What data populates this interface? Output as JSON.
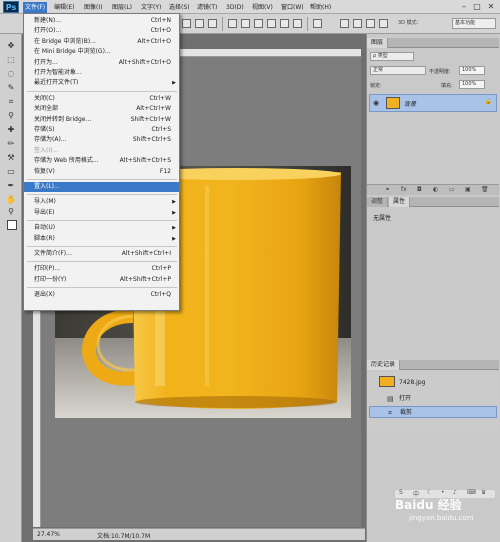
{
  "app": {
    "logo": "Ps"
  },
  "menubar": {
    "items": [
      "文件(F)",
      "编辑(E)",
      "图像(I)",
      "图层(L)",
      "文字(Y)",
      "选择(S)",
      "滤镜(T)",
      "3D(D)",
      "视图(V)",
      "窗口(W)",
      "帮助(H)"
    ],
    "active_index": 0,
    "window_controls": [
      "–",
      "□",
      "✕"
    ]
  },
  "optionsbar": {
    "mode_3d": "3D 模式:",
    "workspace": "基本功能"
  },
  "file_menu": {
    "items": [
      {
        "label": "新建(N)...",
        "shortcut": "Ctrl+N"
      },
      {
        "label": "打开(O)...",
        "shortcut": "Ctrl+O"
      },
      {
        "label": "在 Bridge 中浏览(B)...",
        "shortcut": "Alt+Ctrl+O"
      },
      {
        "label": "在 Mini Bridge 中浏览(G)...",
        "shortcut": ""
      },
      {
        "label": "打开为...",
        "shortcut": "Alt+Shift+Ctrl+O"
      },
      {
        "label": "打开为智能对象...",
        "shortcut": ""
      },
      {
        "label": "最近打开文件(T)",
        "shortcut": "",
        "submenu": true
      },
      {
        "separator": true
      },
      {
        "label": "关闭(C)",
        "shortcut": "Ctrl+W"
      },
      {
        "label": "关闭全部",
        "shortcut": "Alt+Ctrl+W"
      },
      {
        "label": "关闭并转到 Bridge...",
        "shortcut": "Shift+Ctrl+W"
      },
      {
        "label": "存储(S)",
        "shortcut": "Ctrl+S"
      },
      {
        "label": "存储为(A)...",
        "shortcut": "Shift+Ctrl+S"
      },
      {
        "label": "签入(I)...",
        "shortcut": "",
        "disabled": true
      },
      {
        "label": "存储为 Web 所用格式...",
        "shortcut": "Alt+Shift+Ctrl+S"
      },
      {
        "label": "恢复(V)",
        "shortcut": "F12"
      },
      {
        "separator": true
      },
      {
        "label": "置入(L)...",
        "shortcut": "",
        "highlight": true
      },
      {
        "separator": true
      },
      {
        "label": "导入(M)",
        "shortcut": "",
        "submenu": true
      },
      {
        "label": "导出(E)",
        "shortcut": "",
        "submenu": true
      },
      {
        "separator": true
      },
      {
        "label": "自动(U)",
        "shortcut": "",
        "submenu": true
      },
      {
        "label": "脚本(R)",
        "shortcut": "",
        "submenu": true
      },
      {
        "separator": true
      },
      {
        "label": "文件简介(F)...",
        "shortcut": "Alt+Shift+Ctrl+I"
      },
      {
        "separator": true
      },
      {
        "label": "打印(P)...",
        "shortcut": "Ctrl+P"
      },
      {
        "label": "打印一份(Y)",
        "shortcut": "Alt+Shift+Ctrl+P"
      },
      {
        "separator": true
      },
      {
        "label": "退出(X)",
        "shortcut": "Ctrl+Q"
      }
    ]
  },
  "layers_panel": {
    "tab": "图层",
    "kind_filter": "ρ 类型",
    "blend_mode": "正常",
    "opacity_label": "不透明度:",
    "opacity_value": "100%",
    "lock_label": "锁定:",
    "fill_label": "填充:",
    "fill_value": "100%",
    "layer_name": "背景"
  },
  "properties_panel": {
    "tabs": [
      "调整",
      "属性"
    ],
    "active_tab": 1,
    "empty_text": "无属性"
  },
  "history_panel": {
    "tab": "历史记录",
    "snapshot": "7428.jpg",
    "steps": [
      "打开",
      "裁剪"
    ],
    "current_index": 1
  },
  "status": {
    "zoom": "27.47%",
    "doc_size": "文档:10.7M/10.7M"
  },
  "watermark": {
    "logo": "Baidu 经验",
    "url": "jingyan.baidu.com"
  },
  "colors": {
    "mug": "#f2b51e",
    "highlight": "#3a78c8",
    "selected_row": "#a9c3e8"
  }
}
